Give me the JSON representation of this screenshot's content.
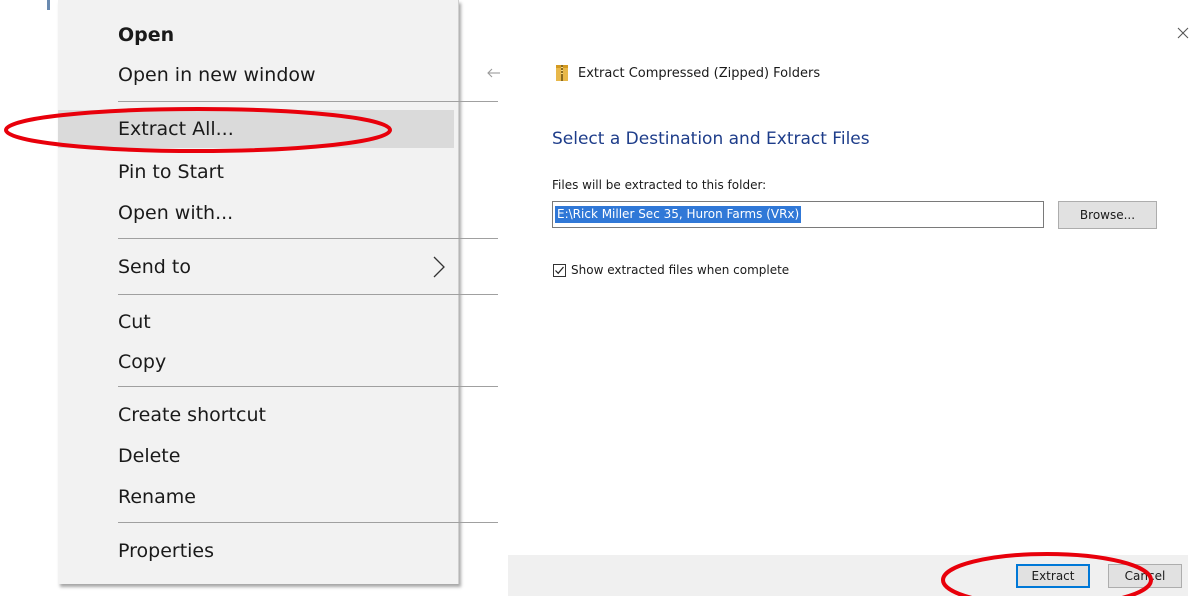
{
  "context_menu": {
    "items": [
      {
        "label": "Open",
        "bold": true
      },
      {
        "label": "Open in new window"
      },
      {
        "label": "Extract All..."
      },
      {
        "label": "Pin to Start"
      },
      {
        "label": "Open with..."
      },
      {
        "label": "Send to"
      },
      {
        "label": "Cut"
      },
      {
        "label": "Copy"
      },
      {
        "label": "Create shortcut"
      },
      {
        "label": "Delete"
      },
      {
        "label": "Rename"
      },
      {
        "label": "Properties"
      }
    ],
    "highlighted_item": "Extract All...",
    "submenu_icon": "chevron-right-icon"
  },
  "dialog": {
    "title": "Extract Compressed (Zipped) Folders",
    "heading": "Select a Destination and Extract Files",
    "destination_label": "Files will be extracted to this folder:",
    "destination_path": "E:\\Rick Miller Sec 35, Huron Farms (VRx)",
    "browse_label": "Browse...",
    "show_files_label": "Show extracted files when complete",
    "show_files_checked": true,
    "extract_label": "Extract",
    "cancel_label": "Cancel",
    "icons": {
      "back": "back-arrow-icon",
      "close": "close-icon",
      "zip": "zip-folder-icon"
    }
  },
  "colors": {
    "heading": "#1e3d8a",
    "selection": "#3078d7",
    "annotation": "#e8000b",
    "primary_border": "#0078d7"
  }
}
